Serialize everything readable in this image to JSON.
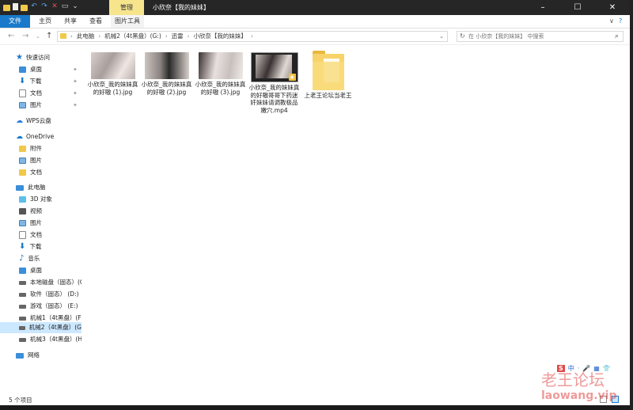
{
  "window": {
    "title": "小欣奈【我的妹妹】",
    "manage_tab": "管理",
    "minimize": "–",
    "maximize": "☐",
    "close": "✕"
  },
  "ribbon": {
    "tabs": [
      "文件",
      "主页",
      "共享",
      "查看",
      "图片工具"
    ],
    "chevron": "∨",
    "help": "?"
  },
  "address": {
    "crumbs": [
      "此电脑",
      "机械2（4t黑盘）(G:)",
      "迅雷",
      "小欣奈【我的妹妹】"
    ],
    "search_placeholder": "在 小欣奈【我的妹妹】 中搜索"
  },
  "sidebar": {
    "items": [
      {
        "label": "快速访问"
      },
      {
        "label": "桌面"
      },
      {
        "label": "下载"
      },
      {
        "label": "文档"
      },
      {
        "label": "图片"
      },
      {
        "label": "WPS云盘"
      },
      {
        "label": "OneDrive"
      },
      {
        "label": "附件"
      },
      {
        "label": "图片"
      },
      {
        "label": "文档"
      },
      {
        "label": "此电脑"
      },
      {
        "label": "3D 对象"
      },
      {
        "label": "视频"
      },
      {
        "label": "图片"
      },
      {
        "label": "文档"
      },
      {
        "label": "下载"
      },
      {
        "label": "音乐"
      },
      {
        "label": "桌面"
      },
      {
        "label": "本地磁盘（固态）(C"
      },
      {
        "label": "软件（固态） (D:)"
      },
      {
        "label": "游戏（固态） (E:)"
      },
      {
        "label": "机械1（4t黑盘）(F"
      },
      {
        "label": "机械2（4t黑盘）(G"
      },
      {
        "label": "机械3（4t黑盘）(H"
      },
      {
        "label": "网络"
      }
    ]
  },
  "files": [
    {
      "name": "小欣奈_我的妹妹真的好嗷 (1).jpg"
    },
    {
      "name": "小欣奈_我的妹妹真的好嗷 (2).jpg"
    },
    {
      "name": "小欣奈_我的妹妹真的好嗷 (3).jpg"
    },
    {
      "name": "小欣奈_我的妹妹真的好嗷哥哥下药迷奸妹妹请调教极品嫩穴.mp4"
    },
    {
      "name": "上老王论坛当老王"
    }
  ],
  "status": {
    "count": "5 个项目"
  },
  "ime": [
    "中",
    "·",
    "🎤",
    "▦",
    "👕"
  ],
  "watermark": {
    "line1": "老王论坛",
    "line2": "laowang.vip"
  }
}
